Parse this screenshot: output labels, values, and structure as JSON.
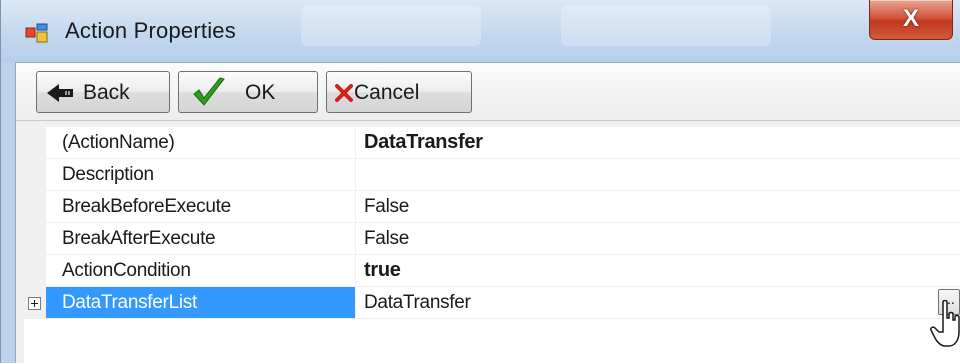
{
  "window": {
    "title": "Action Properties",
    "close_label": "X"
  },
  "toolbar": {
    "back_label": "Back",
    "ok_label": "OK",
    "cancel_label": "Cancel"
  },
  "properties": [
    {
      "name": "(ActionName)",
      "value": "DataTransfer",
      "bold": true
    },
    {
      "name": "Description",
      "value": ""
    },
    {
      "name": "BreakBeforeExecute",
      "value": "False"
    },
    {
      "name": "BreakAfterExecute",
      "value": "False"
    },
    {
      "name": "ActionCondition",
      "value": "true",
      "bold": true
    },
    {
      "name": "DataTransferList",
      "value": "DataTransfer",
      "selected": true,
      "expandable": true,
      "has_ellipsis": true
    }
  ],
  "ellipsis_label": "...",
  "colors": {
    "selection": "#3399ff",
    "close_button": "#c1381f",
    "ok_check": "#2e9d1f",
    "cancel_x": "#d31f1f"
  },
  "icons": [
    "app-icon",
    "back-arrow-icon",
    "check-icon",
    "cancel-x-icon",
    "expand-plus-icon",
    "mouse-cursor-icon"
  ]
}
